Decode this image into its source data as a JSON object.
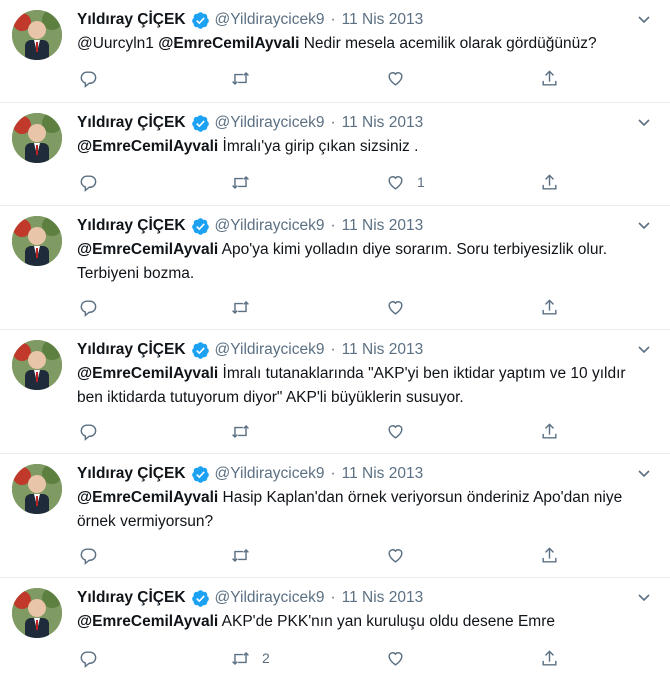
{
  "colors": {
    "name": "#0f1419",
    "secondary": "#5b7083",
    "verified": "#1da1f2",
    "divider": "#e6ecf0"
  },
  "icons": {
    "reply": "reply-icon",
    "retweet": "retweet-icon",
    "like": "heart-icon",
    "share": "share-icon",
    "more": "chevron-down-icon",
    "verified": "verified-badge-icon"
  },
  "tweets": [
    {
      "author": "Yıldıray ÇİÇEK",
      "handle": "@Yildiraycicek9",
      "sep": "·",
      "date": "11 Nis 2013",
      "mention1": "@Uurcyln1",
      "mention2": "@EmreCemilAyvali",
      "text": " Nedir mesela acemilik olarak gördüğünüz?",
      "reply_count": "",
      "retweet_count": "",
      "like_count": ""
    },
    {
      "author": "Yıldıray ÇİÇEK",
      "handle": "@Yildiraycicek9",
      "sep": "·",
      "date": "11 Nis 2013",
      "mention1": "@EmreCemilAyvali",
      "text": " İmralı'ya girip çıkan sizsiniz .",
      "reply_count": "",
      "retweet_count": "",
      "like_count": "1"
    },
    {
      "author": "Yıldıray ÇİÇEK",
      "handle": "@Yildiraycicek9",
      "sep": "·",
      "date": "11 Nis 2013",
      "mention1": "@EmreCemilAyvali",
      "text": " Apo'ya kimi yolladın diye sorarım. Soru terbiyesizlik olur. Terbiyeni bozma.",
      "reply_count": "",
      "retweet_count": "",
      "like_count": ""
    },
    {
      "author": "Yıldıray ÇİÇEK",
      "handle": "@Yildiraycicek9",
      "sep": "·",
      "date": "11 Nis 2013",
      "mention1": "@EmreCemilAyvali",
      "text": " İmralı tutanaklarında \"AKP'yi ben iktidar yaptım ve 10 yıldır ben iktidarda tutuyorum diyor\" AKP'li büyüklerin susuyor.",
      "reply_count": "",
      "retweet_count": "",
      "like_count": ""
    },
    {
      "author": "Yıldıray ÇİÇEK",
      "handle": "@Yildiraycicek9",
      "sep": "·",
      "date": "11 Nis 2013",
      "mention1": "@EmreCemilAyvali",
      "text": " Hasip Kaplan'dan örnek veriyorsun önderiniz Apo'dan niye örnek vermiyorsun?",
      "reply_count": "",
      "retweet_count": "",
      "like_count": ""
    },
    {
      "author": "Yıldıray ÇİÇEK",
      "handle": "@Yildiraycicek9",
      "sep": "·",
      "date": "11 Nis 2013",
      "mention1": "@EmreCemilAyvali",
      "text": " AKP'de PKK'nın yan kuruluşu oldu desene Emre",
      "reply_count": "",
      "retweet_count": "2",
      "like_count": ""
    }
  ]
}
